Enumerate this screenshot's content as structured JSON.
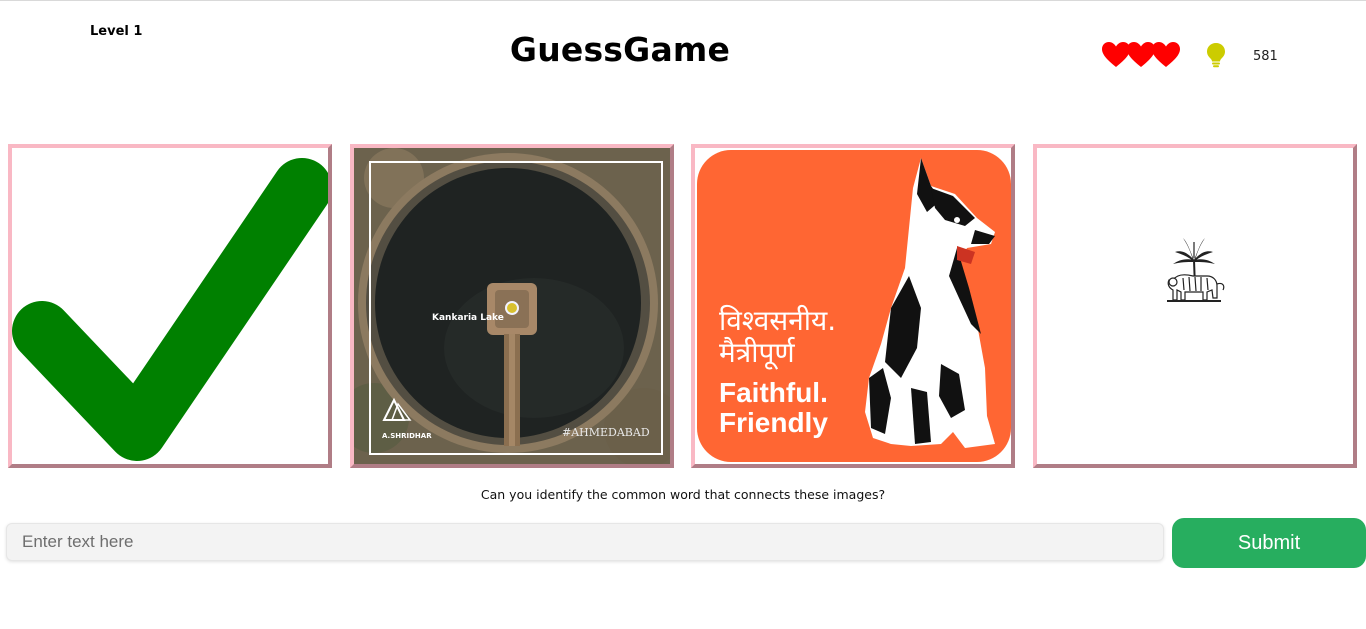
{
  "header": {
    "level": "Level 1",
    "title": "GuessGame",
    "lives": 3,
    "score": "581",
    "heart_color": "#ff0000",
    "hint_color": "#cccc00",
    "lives_icon": "heart-icon",
    "hint_icon": "lightbulb-icon"
  },
  "tiles": [
    {
      "name": "checkmark"
    },
    {
      "name": "kankaria-lake",
      "label": "Kankaria Lake",
      "watermark": "#AHMEDABAD",
      "credit": "A.SHRIDHAR"
    },
    {
      "name": "faithful-friendly",
      "hindi_line1": "विश्वसनीय.",
      "hindi_line2": "मैत्रीपूर्ण",
      "english_line1": "Faithful.",
      "english_line2": "Friendly",
      "bg_color": "#ff6633"
    },
    {
      "name": "rbi-emblem"
    }
  ],
  "prompt": "Can you identify the common word that connects these images?",
  "answer": {
    "placeholder": "Enter text here",
    "value": ""
  },
  "submit_label": "Submit",
  "colors": {
    "submit": "#27ae5f",
    "tile_border_light": "#f9b8c4",
    "tile_border_dark": "#b07d86",
    "check_green": "#008000"
  }
}
